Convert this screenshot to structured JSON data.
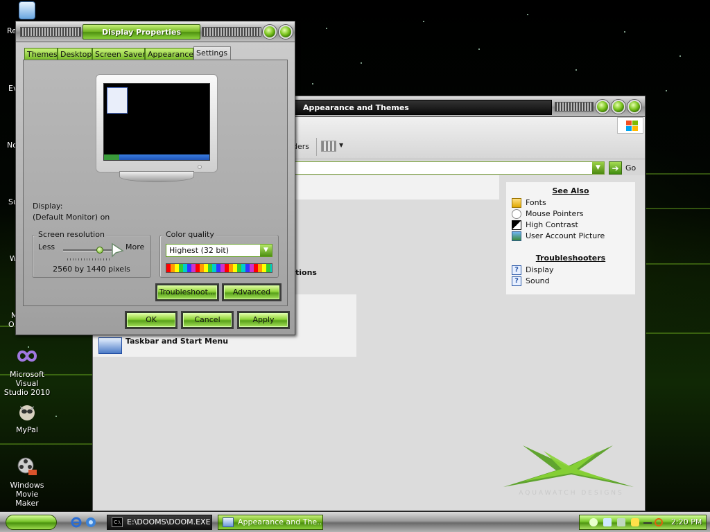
{
  "desktop": {
    "icons": [
      {
        "label": "Microsoft Visual Studio 2010",
        "line1": "Microsoft Visual",
        "line2": "Studio 2010"
      },
      {
        "label": "MyPal",
        "line1": "MyPal",
        "line2": ""
      },
      {
        "label": "Windows Movie Maker",
        "line1": "Windows Movie",
        "line2": "Maker"
      }
    ],
    "cut_labels": [
      "Re",
      "Ev",
      "No",
      "Su",
      "W",
      "M",
      "O"
    ]
  },
  "explorer": {
    "title": "Appearance and Themes",
    "toolbar_fragment": "ders",
    "address_value": "",
    "go_label": "Go",
    "task_fragment": "tions",
    "category_label": "Taskbar and Start Menu",
    "see_also": {
      "heading": "See Also",
      "items": [
        "Fonts",
        "Mouse Pointers",
        "High Contrast",
        "User Account Picture"
      ]
    },
    "troubleshooters": {
      "heading": "Troubleshooters",
      "items": [
        "Display",
        "Sound"
      ]
    },
    "watermark_text": "AQUAWATCH DESIGNS"
  },
  "dialog": {
    "title": "Display Properties",
    "tabs": [
      "Themes",
      "Desktop",
      "Screen Saver",
      "Appearance",
      "Settings"
    ],
    "active_tab": "Settings",
    "display_label": "Display:",
    "display_value": "(Default Monitor) on",
    "resolution": {
      "group_label": "Screen resolution",
      "less_label": "Less",
      "more_label": "More",
      "value_text": "2560 by 1440 pixels",
      "slider_level": 0.75
    },
    "color_quality": {
      "group_label": "Color quality",
      "selected": "Highest (32 bit)"
    },
    "buttons": {
      "troubleshoot": "Troubleshoot...",
      "advanced": "Advanced",
      "ok": "OK",
      "cancel": "Cancel",
      "apply": "Apply"
    }
  },
  "taskbar": {
    "tasks": [
      {
        "label": "E:\\DOOMS\\DOOM.EXE",
        "icon": "cmd-icon",
        "active": false
      },
      {
        "label": "Appearance and The...",
        "icon": "folder-icon",
        "active": true
      }
    ],
    "clock": "2:20 PM"
  },
  "colors": {
    "accent_green": "#7cc520",
    "dark_title": "#0a0a0a"
  }
}
